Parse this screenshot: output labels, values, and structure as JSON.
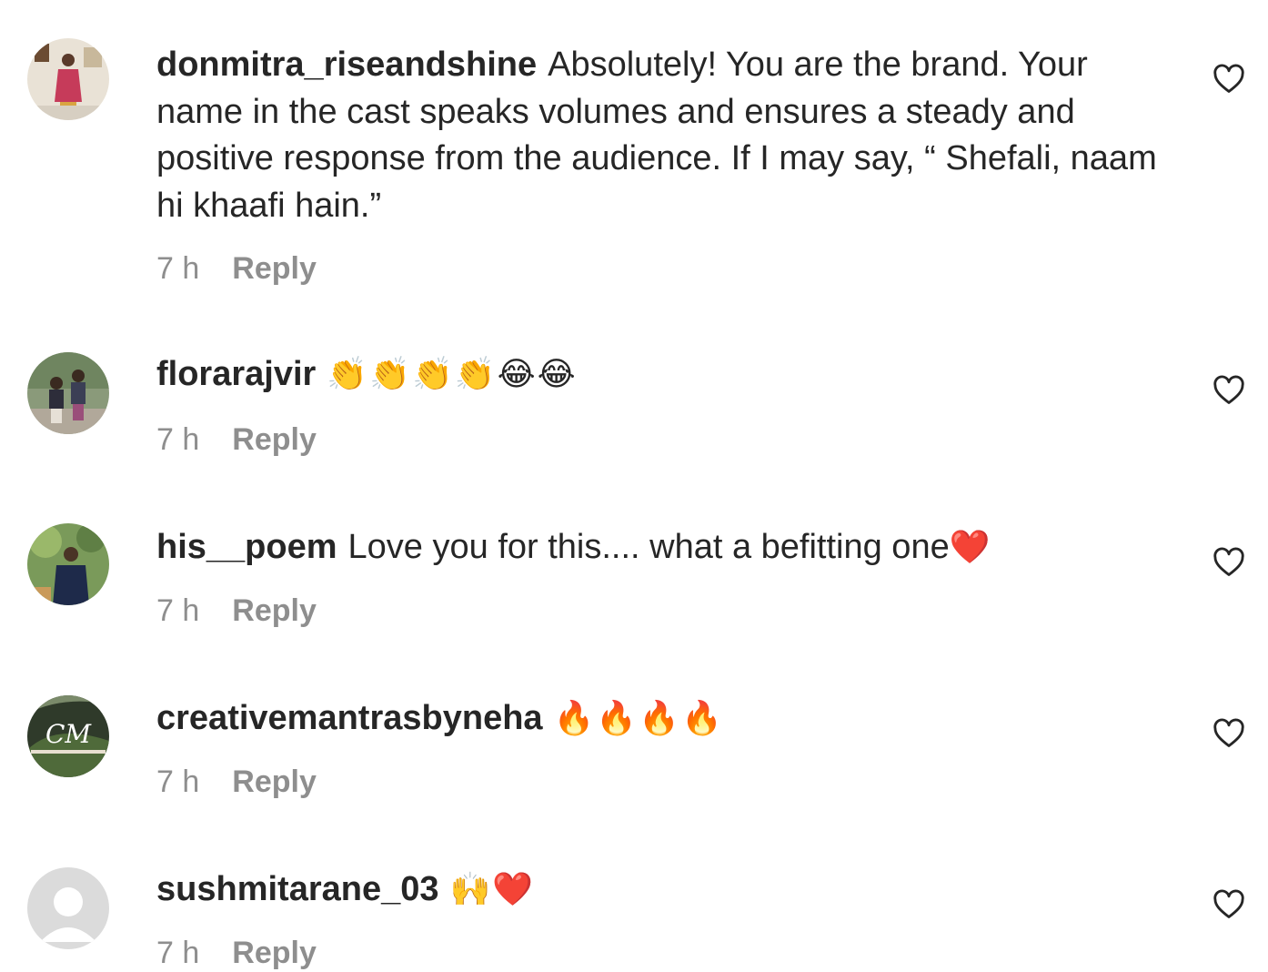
{
  "comments": [
    {
      "username": "donmitra_riseandshine",
      "text": "Absolutely! You are the brand. Your name in the cast speaks volumes and ensures a steady and positive response from the audience. If I may say, “ Shefali, naam hi khaafi hain.”",
      "emoji": "",
      "time": "7 h",
      "reply_label": "Reply"
    },
    {
      "username": "florarajvir",
      "text": "",
      "emoji": "👏👏👏👏😂😂",
      "time": "7 h",
      "reply_label": "Reply"
    },
    {
      "username": "his__poem",
      "text": "Love you for this.... what a befitting one",
      "emoji": "❤️",
      "time": "7 h",
      "reply_label": "Reply"
    },
    {
      "username": "creativemantrasbyneha",
      "text": "",
      "emoji": "🔥🔥🔥🔥",
      "time": "7 h",
      "reply_label": "Reply"
    },
    {
      "username": "sushmitarane_03",
      "text": "",
      "emoji": "🙌❤️",
      "time": "7 h",
      "reply_label": "Reply"
    }
  ],
  "avatar_logo_text": "CM",
  "colors": {
    "text": "#262626",
    "meta": "#8e8e8e",
    "heart_stroke": "#262626"
  },
  "icons": {
    "like": "heart-outline-icon"
  }
}
